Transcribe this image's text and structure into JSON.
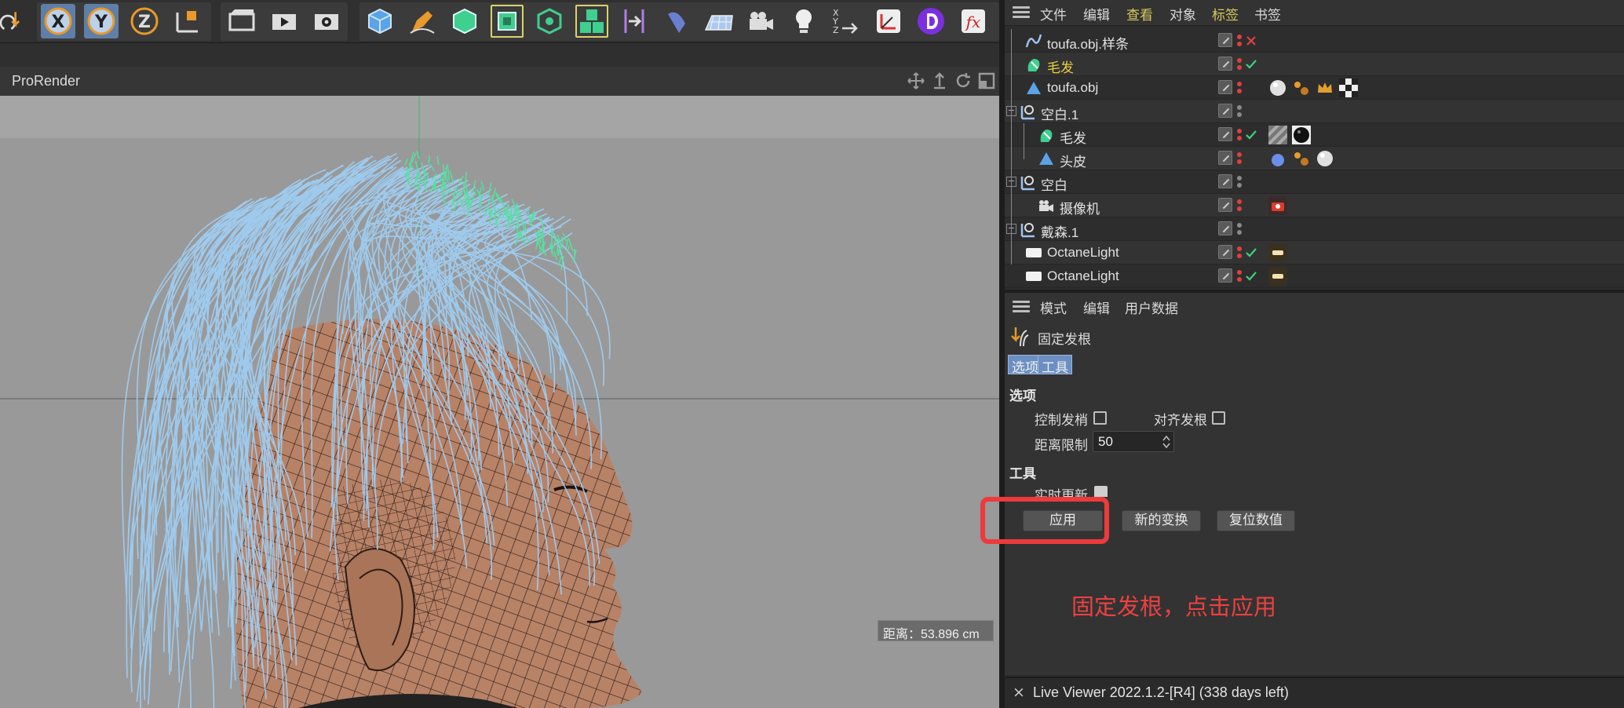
{
  "viewport": {
    "title": "ProRender",
    "distance_readout": "距离：53.896 cm"
  },
  "object_manager": {
    "menu": [
      "文件",
      "编辑",
      "查看",
      "对象",
      "标签",
      "书签"
    ],
    "objects": [
      {
        "name": "toufa.obj.样条",
        "icon": "spline-icon",
        "status": "red-x"
      },
      {
        "name": "毛发",
        "icon": "hair-icon",
        "status": "green-check",
        "selected": true
      },
      {
        "name": "toufa.obj",
        "icon": "polygon-object-icon",
        "status": "none"
      },
      {
        "name": "空白.1",
        "icon": "null-icon",
        "status": "none"
      },
      {
        "name": "毛发",
        "icon": "hair-icon",
        "status": "green-check"
      },
      {
        "name": "头皮",
        "icon": "polygon-object-icon",
        "status": "none"
      },
      {
        "name": "空白",
        "icon": "null-icon",
        "status": "none"
      },
      {
        "name": "摄像机",
        "icon": "camera-icon",
        "status": "none"
      },
      {
        "name": "戴森.1",
        "icon": "null-icon",
        "status": "none"
      },
      {
        "name": "OctaneLight",
        "icon": "light-icon",
        "status": "green-check"
      },
      {
        "name": "OctaneLight",
        "icon": "light-icon",
        "status": "green-check"
      }
    ]
  },
  "attribute_manager": {
    "menu": [
      "模式",
      "编辑",
      "用户数据"
    ],
    "tool_name": "固定发根",
    "tabs": [
      "选项",
      "工具"
    ],
    "options_heading": "选项",
    "control_tips_label": "控制发梢",
    "align_roots_label": "对齐发根",
    "distance_limit_label": "距离限制",
    "distance_limit_value": "50",
    "tool_heading": "工具",
    "realtime_update_label": "实时更新",
    "apply_button": "应用",
    "new_transform_button": "新的变换",
    "reset_values_button": "复位数值"
  },
  "annotation": "固定发根，点击应用",
  "status_bar": {
    "close": "×",
    "text": "Live Viewer 2022.1.2-[R4] (338 days left)"
  },
  "colors": {
    "accent_yellow": "#e7cf3c",
    "hair_blue": "#9fcdf2",
    "annotation_red": "#ee3a3a",
    "tab_blue": "#6b8fc3"
  }
}
